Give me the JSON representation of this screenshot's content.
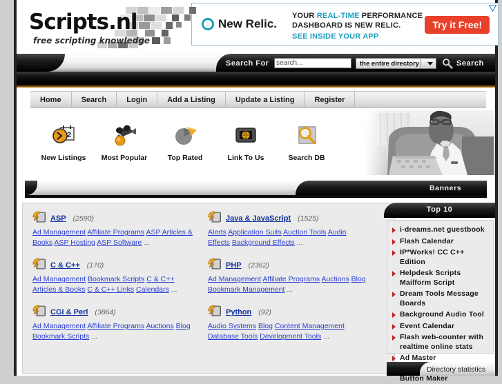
{
  "site": {
    "logo_text": "Scripts.nl",
    "logo_tagline": "free scripting knowledge"
  },
  "ad": {
    "brand": "New Relic.",
    "line1_a": "YOUR ",
    "line1_hl": "REAL-TIME",
    "line1_b": " PERFORMANCE",
    "line2": "DASHBOARD IS NEW RELIC.",
    "line3": "SEE INSIDE YOUR APP",
    "cta": "Try it Free!",
    "brand_color": "#1b9ebd",
    "cta_color": "#e8402a"
  },
  "search": {
    "label": "Search For",
    "input_value": "search...",
    "placeholder": "search...",
    "scope_selected": "the entire directory",
    "scope_options": [
      "the entire directory"
    ],
    "button_label": "Search"
  },
  "nav": {
    "items": [
      {
        "label": "Home"
      },
      {
        "label": "Search"
      },
      {
        "label": "Login"
      },
      {
        "label": "Add a Listing"
      },
      {
        "label": "Update a Listing"
      },
      {
        "label": "Register"
      }
    ]
  },
  "quicklinks": [
    {
      "label": "New Listings",
      "icon": "calendar-clock-icon"
    },
    {
      "label": "Most Popular",
      "icon": "video-camera-icon"
    },
    {
      "label": "Top Rated",
      "icon": "pie-chart-icon"
    },
    {
      "label": "Link To Us",
      "icon": "globe-screen-icon"
    },
    {
      "label": "Search DB",
      "icon": "magnifier-database-icon"
    }
  ],
  "banners_tab": {
    "label": "Banners"
  },
  "categories": [
    {
      "title": "ASP",
      "count": "(2590)",
      "subs": [
        "Ad Management",
        "Affiliate Programs",
        "ASP Articles & Books",
        "ASP Hosting",
        "ASP Software"
      ],
      "more": "..."
    },
    {
      "title": "Java & JavaScript",
      "count": "(1525)",
      "subs": [
        "Alerts",
        "Application Suits",
        "Auction Tools",
        "Audio Effects",
        "Background Effects"
      ],
      "more": "..."
    },
    {
      "title": "C & C++",
      "count": "(170)",
      "subs": [
        "Ad Management",
        "Bookmark Scripts",
        "C & C++ Articles & Books",
        "C & C++ Links",
        "Calendars"
      ],
      "more": "..."
    },
    {
      "title": "PHP",
      "count": "(2362)",
      "subs": [
        "Ad Management",
        "Affiliate Programs",
        "Auctions",
        "Blog",
        "Bookmark Management"
      ],
      "more": "..."
    },
    {
      "title": "CGI & Perl",
      "count": "(3864)",
      "subs": [
        "Ad Management",
        "Affiliate Programs",
        "Auctions",
        "Blog",
        "Bookmark Scripts"
      ],
      "more": "..."
    },
    {
      "title": "Python",
      "count": "(92)",
      "subs": [
        "Audio Systems",
        "Blog",
        "Content Management",
        "Database Tools",
        "Development Tools"
      ],
      "more": "..."
    }
  ],
  "sidebar": {
    "title": "Top 10",
    "items": [
      "i-dreams.net guestbook",
      "Flash Calendar",
      "IP*Works! CC C++ Edition",
      "Helpdesk Scripts Mailform Script",
      "Dream Tools Message Boards",
      "Background Audio Tool",
      "Event Calendar",
      "Flash web-counter with realtime online stats",
      "Ad Master",
      "Amara Flash Menu and Button Maker"
    ],
    "bullet_color": "#c2221c"
  },
  "footer_tab": {
    "label": "Directory statistics"
  }
}
